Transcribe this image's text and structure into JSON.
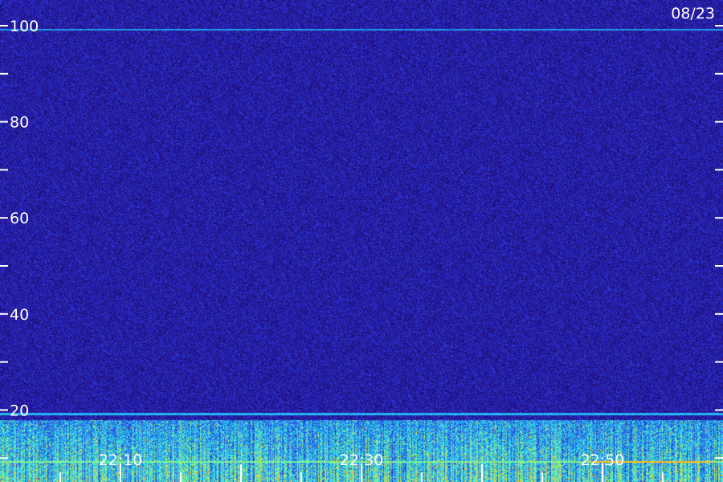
{
  "chart_data": {
    "type": "heatmap",
    "title": "",
    "date_label": "08/23",
    "y_axis": {
      "range": [
        0,
        100
      ],
      "tick_step": 10,
      "labeled_ticks": [
        {
          "value": 100,
          "label": "100"
        },
        {
          "value": 80,
          "label": "80"
        },
        {
          "value": 60,
          "label": "60"
        },
        {
          "value": 40,
          "label": "40"
        },
        {
          "value": 20,
          "label": "20"
        }
      ]
    },
    "x_axis": {
      "start": "22:03",
      "end": "22:59",
      "minor_tick_minutes": 5,
      "labeled_ticks": [
        {
          "value": "22:10",
          "label": "22:10"
        },
        {
          "value": "22:30",
          "label": "22:30"
        },
        {
          "value": "22:50",
          "label": "22:50"
        }
      ]
    },
    "colormap": [
      "#12063f",
      "#1f0f7a",
      "#2a1fb5",
      "#2d45e0",
      "#1f9be8",
      "#2ee0ff",
      "#9dff6b",
      "#ffd21f",
      "#ff7a1a"
    ],
    "features": [
      {
        "kind": "horizontal_line",
        "y": 99.2,
        "level": 0.55
      },
      {
        "kind": "horizontal_line",
        "y": 19.2,
        "level": 0.6
      },
      {
        "kind": "horizontal_line",
        "y": 9.3,
        "level": 0.75,
        "segments": [
          {
            "x_start": "22:03",
            "x_end": "22:49",
            "level": 0.75
          },
          {
            "x_start": "22:49",
            "x_end": "22:59",
            "level": 0.95
          }
        ]
      },
      {
        "kind": "band",
        "y_range": [
          0,
          18
        ],
        "level": 0.55
      }
    ]
  }
}
